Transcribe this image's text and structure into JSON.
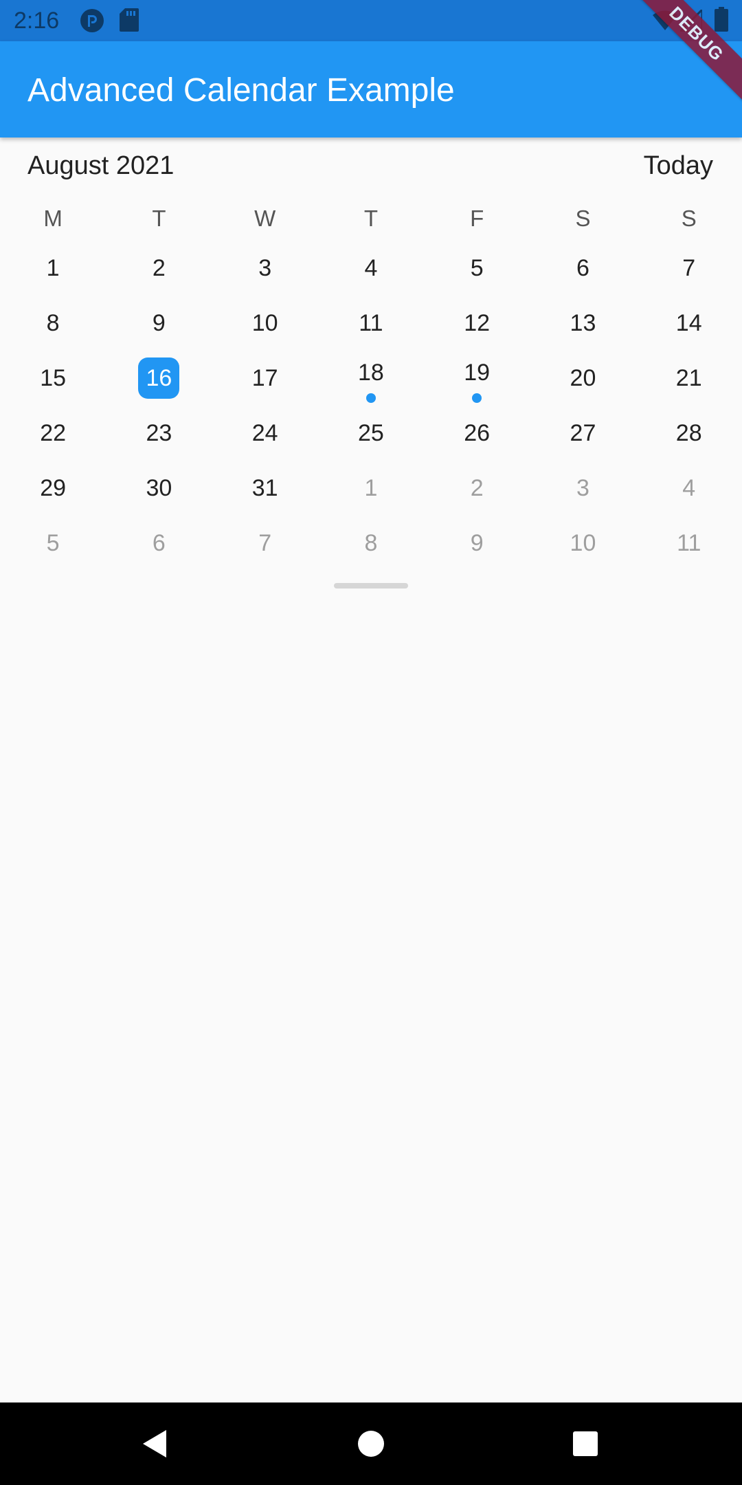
{
  "status_bar": {
    "time": "2:16",
    "icons": [
      "pocket-casts-icon",
      "sd-card-icon",
      "wifi-icon",
      "signal-icon",
      "battery-icon"
    ]
  },
  "app_bar": {
    "title": "Advanced Calendar Example"
  },
  "debug_banner": {
    "label": "DEBUG"
  },
  "calendar": {
    "month_label": "August 2021",
    "today_label": "Today",
    "weekdays": [
      "M",
      "T",
      "W",
      "T",
      "F",
      "S",
      "S"
    ],
    "weeks": [
      [
        {
          "d": "1"
        },
        {
          "d": "2"
        },
        {
          "d": "3"
        },
        {
          "d": "4"
        },
        {
          "d": "5"
        },
        {
          "d": "6"
        },
        {
          "d": "7"
        }
      ],
      [
        {
          "d": "8"
        },
        {
          "d": "9"
        },
        {
          "d": "10"
        },
        {
          "d": "11"
        },
        {
          "d": "12"
        },
        {
          "d": "13"
        },
        {
          "d": "14"
        }
      ],
      [
        {
          "d": "15"
        },
        {
          "d": "16",
          "selected": true
        },
        {
          "d": "17"
        },
        {
          "d": "18",
          "event": true
        },
        {
          "d": "19",
          "event": true
        },
        {
          "d": "20"
        },
        {
          "d": "21"
        }
      ],
      [
        {
          "d": "22"
        },
        {
          "d": "23"
        },
        {
          "d": "24"
        },
        {
          "d": "25"
        },
        {
          "d": "26"
        },
        {
          "d": "27"
        },
        {
          "d": "28"
        }
      ],
      [
        {
          "d": "29"
        },
        {
          "d": "30"
        },
        {
          "d": "31"
        },
        {
          "d": "1",
          "outside": true
        },
        {
          "d": "2",
          "outside": true
        },
        {
          "d": "3",
          "outside": true
        },
        {
          "d": "4",
          "outside": true
        }
      ],
      [
        {
          "d": "5",
          "outside": true
        },
        {
          "d": "6",
          "outside": true
        },
        {
          "d": "7",
          "outside": true
        },
        {
          "d": "8",
          "outside": true
        },
        {
          "d": "9",
          "outside": true
        },
        {
          "d": "10",
          "outside": true
        },
        {
          "d": "11",
          "outside": true
        }
      ]
    ]
  },
  "nav_bar": {
    "buttons": [
      "back-icon",
      "home-icon",
      "recents-icon"
    ]
  },
  "colors": {
    "primary": "#2196f3",
    "status_bar": "#1976d2",
    "selected_day": "#2196f3",
    "event_dot": "#2196f3",
    "outside_day_text": "#9e9e9e",
    "debug_banner": "#8b1a3a"
  }
}
